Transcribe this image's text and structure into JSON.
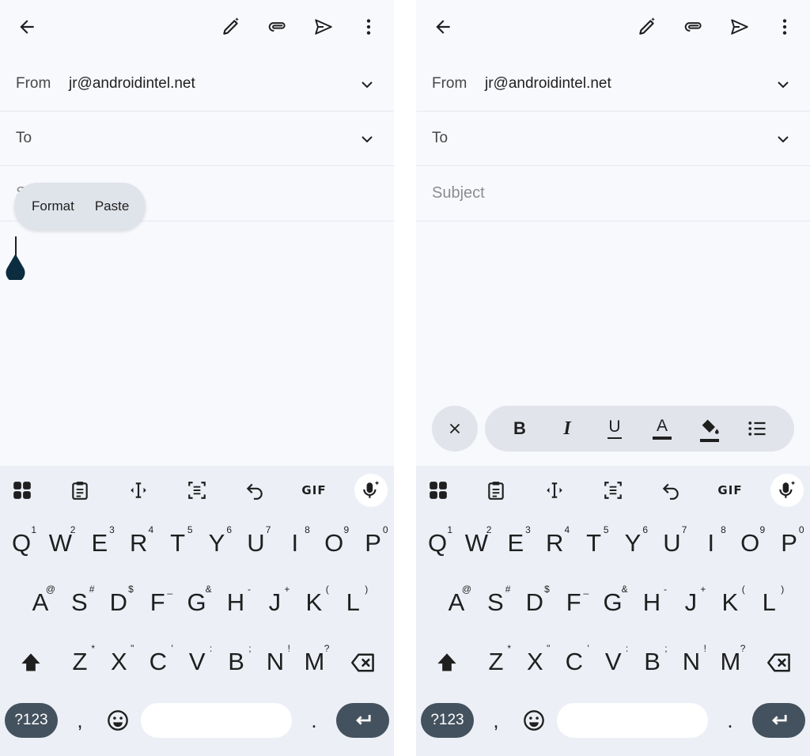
{
  "left_screen": {
    "from_label": "From",
    "from_value": "jr@androidintel.net",
    "to_label": "To",
    "subject_partial": "S",
    "popup": {
      "format": "Format",
      "paste": "Paste"
    }
  },
  "right_screen": {
    "from_label": "From",
    "from_value": "jr@androidintel.net",
    "to_label": "To",
    "subject_placeholder": "Subject",
    "format_toolbar": {
      "bold": "B",
      "italic": "I",
      "underline": "U",
      "text_color": "A",
      "icons": [
        "close-icon",
        "bold-icon",
        "italic-icon",
        "underline-icon",
        "text-color-icon",
        "highlight-icon",
        "bulleted-list-icon"
      ]
    }
  },
  "appbar_icons": [
    "back-arrow-icon",
    "help-me-write-icon",
    "attach-icon",
    "send-icon",
    "more-vert-icon"
  ],
  "keyboard": {
    "toolbar_icons": [
      "apps-grid-icon",
      "clipboard-icon",
      "cursor-move-icon",
      "select-text-icon",
      "undo-icon",
      "gif-icon",
      "voice-mic-icon"
    ],
    "gif_label": "GIF",
    "row1": [
      {
        "k": "Q",
        "h": "1"
      },
      {
        "k": "W",
        "h": "2"
      },
      {
        "k": "E",
        "h": "3"
      },
      {
        "k": "R",
        "h": "4"
      },
      {
        "k": "T",
        "h": "5"
      },
      {
        "k": "Y",
        "h": "6"
      },
      {
        "k": "U",
        "h": "7"
      },
      {
        "k": "I",
        "h": "8"
      },
      {
        "k": "O",
        "h": "9"
      },
      {
        "k": "P",
        "h": "0"
      }
    ],
    "row2": [
      {
        "k": "A",
        "h": "@"
      },
      {
        "k": "S",
        "h": "#"
      },
      {
        "k": "D",
        "h": "$"
      },
      {
        "k": "F",
        "h": "_"
      },
      {
        "k": "G",
        "h": "&"
      },
      {
        "k": "H",
        "h": "-"
      },
      {
        "k": "J",
        "h": "+"
      },
      {
        "k": "K",
        "h": "("
      },
      {
        "k": "L",
        "h": ")"
      }
    ],
    "row3": [
      {
        "k": "Z",
        "h": "*"
      },
      {
        "k": "X",
        "h": "\""
      },
      {
        "k": "C",
        "h": "'"
      },
      {
        "k": "V",
        "h": ":"
      },
      {
        "k": "B",
        "h": ";"
      },
      {
        "k": "N",
        "h": "!"
      },
      {
        "k": "M",
        "h": "?"
      }
    ],
    "symbols_label": "?123",
    "comma": ",",
    "period": "."
  },
  "colors": {
    "screen_bg": "#f8f9fd",
    "keyboard_bg": "#ecf0f6",
    "special_key": "#44515e",
    "cursor_handle": "#0b2d3f",
    "chip_bg": "#e1e4eb"
  }
}
